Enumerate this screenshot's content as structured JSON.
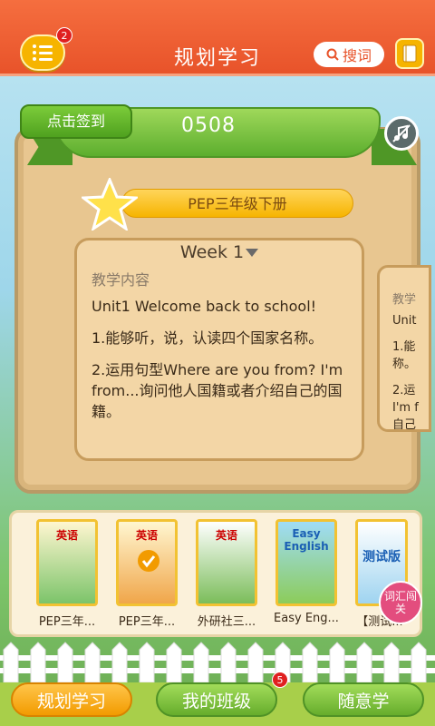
{
  "header": {
    "title": "规划学习",
    "menu_badge": "2",
    "search_label": "搜词"
  },
  "checkin": {
    "label": "点击签到"
  },
  "date_code": "0508",
  "book_title": "PEP三年级下册",
  "week_card": {
    "week": "Week 1",
    "label": "教学内容",
    "unit": "Unit1 Welcome back to school!",
    "point1": "1.能够听，说，认读四个国家名称。",
    "point2": "2.运用句型Where are you from? I'm from...询问他人国籍或者介绍自己的国籍。"
  },
  "next_card": {
    "label": "教学",
    "line1": "Unit",
    "line2": "1.能",
    "line3": "称。",
    "line4": "2.运",
    "line5": "I'm f",
    "line6": "自己"
  },
  "books": [
    {
      "name": "PEP三年...",
      "cover": "英语"
    },
    {
      "name": "PEP三年...",
      "cover": "英语"
    },
    {
      "name": "外研社三...",
      "cover": "英语"
    },
    {
      "name": "Easy Eng...",
      "cover": "Easy English"
    },
    {
      "name": "【测试...",
      "cover": "测试版"
    }
  ],
  "vocab_button": "词汇闯关",
  "nav": {
    "plan": "规划学习",
    "class": "我的班级",
    "class_badge": "5",
    "free": "随意学"
  },
  "colors": {
    "header": "#e8532a",
    "accent": "#f6b400",
    "green": "#5cae2e"
  }
}
